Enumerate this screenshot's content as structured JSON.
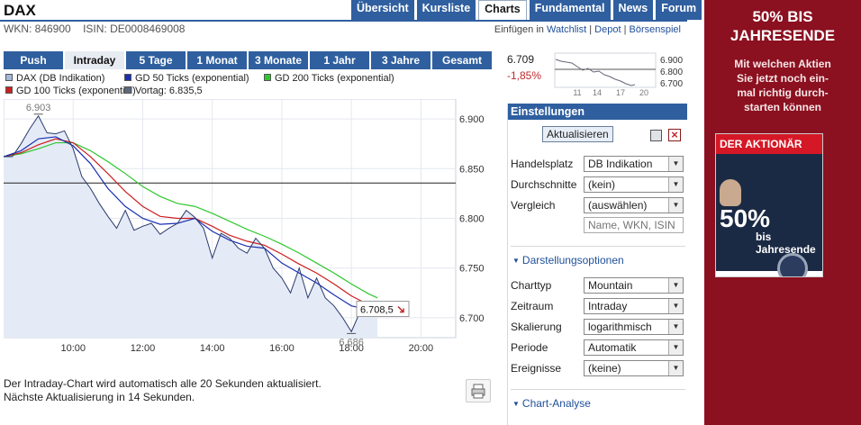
{
  "header": {
    "title": "DAX",
    "wkn": "WKN: 846900",
    "isin": "ISIN: DE0008469008",
    "nav_tabs": [
      "Übersicht",
      "Kursliste",
      "Charts",
      "Fundamental",
      "News",
      "Forum"
    ],
    "active_tab": "Charts",
    "links_prefix": "Einfügen in",
    "links": [
      "Watchlist",
      "Depot",
      "Börsenspiel"
    ]
  },
  "ranges": {
    "items": [
      "Push",
      "Intraday",
      "5 Tage",
      "1 Monat",
      "3 Monate",
      "1 Jahr",
      "3 Jahre",
      "Gesamt"
    ],
    "active": "Intraday"
  },
  "legend": [
    {
      "label": "DAX (DB Indikation)",
      "color": "#a4b9d8"
    },
    {
      "label": "GD 50 Ticks (exponential)",
      "color": "#1a2fb0"
    },
    {
      "label": "GD 200 Ticks (exponential)",
      "color": "#2ec82e"
    },
    {
      "label": "GD 100 Ticks (exponential)",
      "color": "#cc1f1f"
    },
    {
      "label": "Vortag: 6.835,5",
      "color": "#5b6b7f"
    }
  ],
  "chart_data": {
    "type": "line",
    "x_ticks": [
      "10:00",
      "12:00",
      "14:00",
      "16:00",
      "18:00",
      "20:00"
    ],
    "y_ticks": [
      "6.900",
      "6.850",
      "6.800",
      "6.750",
      "6.700"
    ],
    "ylim": [
      6680,
      6920
    ],
    "xlim": [
      8.0,
      21.0
    ],
    "reference_line": 6835.5,
    "annotations": {
      "high": "6.903",
      "low": "6.686",
      "last": "6.708,5"
    },
    "series": [
      {
        "name": "DAX (DB Indikation)",
        "color": "#2a3a6c",
        "x": [
          8.0,
          8.25,
          8.5,
          8.75,
          9.0,
          9.25,
          9.5,
          9.75,
          10.0,
          10.25,
          10.5,
          10.75,
          11.0,
          11.25,
          11.5,
          11.75,
          12.0,
          12.25,
          12.5,
          12.75,
          13.0,
          13.25,
          13.5,
          13.75,
          14.0,
          14.25,
          14.5,
          14.75,
          15.0,
          15.25,
          15.5,
          15.75,
          16.0,
          16.25,
          16.5,
          16.75,
          17.0,
          17.25,
          17.5,
          17.75,
          18.0,
          18.25,
          18.5,
          18.75
        ],
        "y": [
          6862,
          6862,
          6875,
          6890,
          6903,
          6886,
          6885,
          6888,
          6870,
          6842,
          6830,
          6815,
          6802,
          6790,
          6808,
          6788,
          6792,
          6795,
          6784,
          6790,
          6795,
          6808,
          6801,
          6790,
          6760,
          6785,
          6780,
          6770,
          6765,
          6780,
          6770,
          6750,
          6740,
          6725,
          6750,
          6720,
          6740,
          6720,
          6712,
          6700,
          6686,
          6706,
          6705,
          6708.5
        ]
      },
      {
        "name": "GD 50 Ticks (exponential)",
        "color": "#1a2fb0",
        "x": [
          8.0,
          8.5,
          9.0,
          9.5,
          10.0,
          10.5,
          11.0,
          11.5,
          12.0,
          12.5,
          13.0,
          13.5,
          14.0,
          14.5,
          15.0,
          15.5,
          16.0,
          16.5,
          17.0,
          17.5,
          18.0,
          18.5,
          18.75
        ],
        "y": [
          6862,
          6868,
          6880,
          6882,
          6873,
          6855,
          6830,
          6812,
          6800,
          6794,
          6795,
          6800,
          6787,
          6778,
          6772,
          6770,
          6755,
          6745,
          6735,
          6723,
          6712,
          6708,
          6708
        ]
      },
      {
        "name": "GD 100 Ticks (exponential)",
        "color": "#cc1f1f",
        "x": [
          8.0,
          8.5,
          9.0,
          9.5,
          10.0,
          10.5,
          11.0,
          11.5,
          12.0,
          12.5,
          13.0,
          13.5,
          14.0,
          14.5,
          15.0,
          15.5,
          16.0,
          16.5,
          17.0,
          17.5,
          18.0,
          18.5,
          18.75
        ],
        "y": [
          6862,
          6866,
          6874,
          6880,
          6876,
          6862,
          6845,
          6827,
          6812,
          6802,
          6800,
          6800,
          6792,
          6783,
          6777,
          6773,
          6764,
          6754,
          6745,
          6734,
          6722,
          6713,
          6711
        ]
      },
      {
        "name": "GD 200 Ticks (exponential)",
        "color": "#2ec82e",
        "x": [
          8.0,
          8.5,
          9.0,
          9.5,
          10.0,
          10.5,
          11.0,
          11.5,
          12.0,
          12.5,
          13.0,
          13.5,
          14.0,
          14.5,
          15.0,
          15.5,
          16.0,
          16.5,
          17.0,
          17.5,
          18.0,
          18.5,
          18.75
        ],
        "y": [
          6862,
          6865,
          6870,
          6876,
          6876,
          6868,
          6857,
          6845,
          6832,
          6822,
          6815,
          6812,
          6805,
          6797,
          6789,
          6782,
          6774,
          6765,
          6755,
          6745,
          6734,
          6724,
          6720
        ]
      }
    ]
  },
  "info": {
    "line1": "Der Intraday-Chart wird automatisch alle 20 Sekunden aktualisiert.",
    "line2": "Nächste Aktualisierung in 14 Sekunden."
  },
  "quote": {
    "price": "6.709",
    "change": "-1,85%",
    "mini_y_ticks": [
      "6.900",
      "6.800",
      "6.700"
    ],
    "mini_x_ticks": [
      "11",
      "14",
      "17",
      "20"
    ]
  },
  "settings": {
    "title": "Einstellungen",
    "update_button": "Aktualisieren",
    "handelsplatz_label": "Handelsplatz",
    "handelsplatz_value": "DB Indikation",
    "durchschnitte_label": "Durchschnitte",
    "durchschnitte_value": "(kein)",
    "vergleich_label": "Vergleich",
    "vergleich_value": "(auswählen)",
    "vergleich_placeholder": "Name, WKN, ISIN",
    "darstellung_title": "Darstellungsoptionen",
    "charttyp_label": "Charttyp",
    "charttyp_value": "Mountain",
    "zeitraum_label": "Zeitraum",
    "zeitraum_value": "Intraday",
    "skalierung_label": "Skalierung",
    "skalierung_value": "logarithmisch",
    "periode_label": "Periode",
    "periode_value": "Automatik",
    "ereignisse_label": "Ereignisse",
    "ereignisse_value": "(keine)",
    "analyse_title": "Chart-Analyse"
  },
  "ad": {
    "headline1": "50% BIS",
    "headline2": "JAHRESENDE",
    "sub1": "Mit welchen Aktien",
    "sub2": "Sie jetzt noch ein-",
    "sub3": "mal richtig durch-",
    "sub4": "starten können",
    "magazine_name": "DER AKTIONÄR",
    "magazine_big": "50%",
    "magazine_small": "bis Jahresende"
  }
}
